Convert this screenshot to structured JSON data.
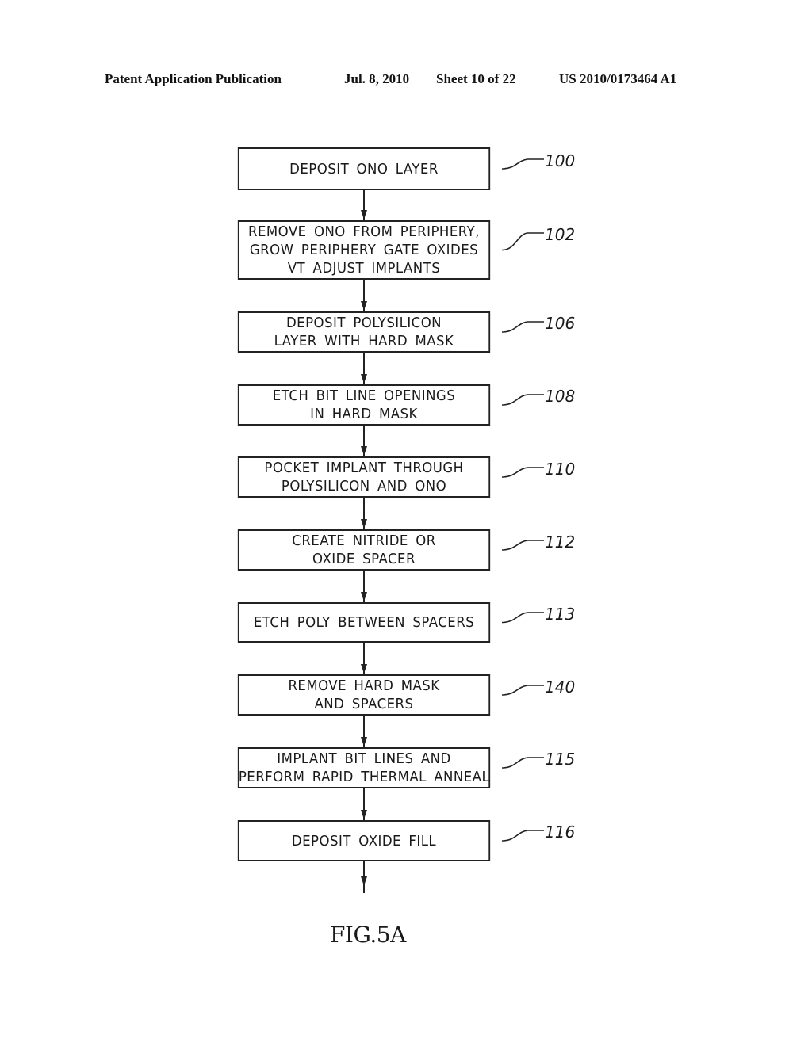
{
  "header": {
    "title": "Patent Application Publication",
    "date": "Jul. 8, 2010",
    "sheet": "Sheet 10 of 22",
    "number": "US 2010/0173464 A1"
  },
  "steps": [
    {
      "ref": "100",
      "lines": [
        "DEPOSIT  ONO  LAYER"
      ]
    },
    {
      "ref": "102",
      "lines": [
        "REMOVE  ONO  FROM  PERIPHERY,",
        "GROW  PERIPHERY  GATE  OXIDES",
        "VT  ADJUST  IMPLANTS"
      ]
    },
    {
      "ref": "106",
      "lines": [
        "DEPOSIT  POLYSILICON",
        "LAYER  WITH  HARD  MASK"
      ]
    },
    {
      "ref": "108",
      "lines": [
        "ETCH  BIT  LINE  OPENINGS",
        "IN  HARD  MASK"
      ]
    },
    {
      "ref": "110",
      "lines": [
        "POCKET  IMPLANT  THROUGH",
        "POLYSILICON  AND  ONO"
      ]
    },
    {
      "ref": "112",
      "lines": [
        "CREATE  NITRIDE  OR",
        "OXIDE  SPACER"
      ]
    },
    {
      "ref": "113",
      "lines": [
        "ETCH  POLY  BETWEEN  SPACERS"
      ]
    },
    {
      "ref": "140",
      "lines": [
        "REMOVE  HARD  MASK",
        "AND  SPACERS"
      ]
    },
    {
      "ref": "115",
      "lines": [
        "IMPLANT  BIT  LINES  AND",
        "PERFORM  RAPID  THERMAL  ANNEAL"
      ]
    },
    {
      "ref": "116",
      "lines": [
        "DEPOSIT  OXIDE  FILL"
      ]
    }
  ],
  "figure_label": "FIG.5A"
}
